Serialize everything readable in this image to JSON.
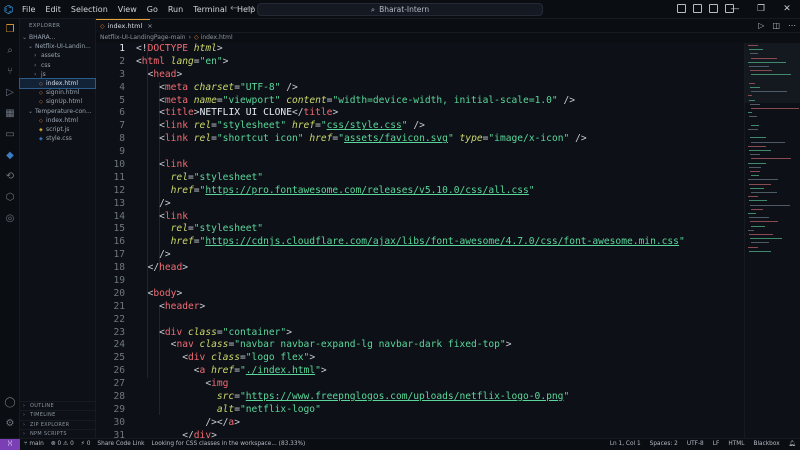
{
  "titlebar": {
    "menu": [
      "File",
      "Edit",
      "Selection",
      "View",
      "Go",
      "Run",
      "Terminal",
      "Help"
    ],
    "search_text": "Bharat-Intern",
    "search_icon": "search-icon",
    "window_controls": [
      "—",
      "❐",
      "✕"
    ]
  },
  "sidebar": {
    "header": "EXPLORER",
    "root": "BHARA...",
    "items": [
      {
        "label": "Netflix-UI-Landin...",
        "kind": "folder-open"
      },
      {
        "label": "assets",
        "kind": "folder"
      },
      {
        "label": "css",
        "kind": "folder"
      },
      {
        "label": "js",
        "kind": "folder"
      },
      {
        "label": "index.html",
        "kind": "html"
      },
      {
        "label": "signin.html",
        "kind": "html"
      },
      {
        "label": "signUp.html",
        "kind": "html"
      },
      {
        "label": "Temperature-con...",
        "kind": "folder-open"
      },
      {
        "label": "index.html",
        "kind": "html"
      },
      {
        "label": "script.js",
        "kind": "js"
      },
      {
        "label": "style.css",
        "kind": "css"
      }
    ],
    "panels": [
      "OUTLINE",
      "TIMELINE",
      "ZIP EXPLORER",
      "NPM SCRIPTS"
    ]
  },
  "tabs": {
    "active": {
      "label": "index.html",
      "close": "×"
    }
  },
  "breadcrumb": {
    "folder": "Netflix-UI-LandingPage-main",
    "file": "index.html",
    "separator": "›"
  },
  "editor": {
    "current_line": 1,
    "line_numbers": [
      "1",
      "2",
      "3",
      "4",
      "5",
      "6",
      "7",
      "8",
      "9",
      "10",
      "11",
      "12",
      "13",
      "14",
      "15",
      "16",
      "17",
      "18",
      "19",
      "20",
      "21",
      "22",
      "23",
      "24",
      "25",
      "26",
      "27",
      "28",
      "29",
      "30",
      "31"
    ]
  },
  "statusbar": {
    "branch": "main",
    "problems": "⊗ 0 ⚠ 0",
    "ports": "⚡ 0",
    "share": "Share Code Link",
    "message": "Looking for CSS classes in the workspace... (83.33%)",
    "position": "Ln 1, Col 1",
    "spaces": "Spaces: 2",
    "encoding": "UTF-8",
    "eol": "LF",
    "language": "HTML",
    "formatter": "Blackbox"
  },
  "colors": {
    "background": "#0d1117",
    "accent": "#e8a23a",
    "tag": "#f06b72",
    "attribute": "#cbd86a",
    "string": "#5ad69a",
    "remote": "#7a3fb5"
  }
}
